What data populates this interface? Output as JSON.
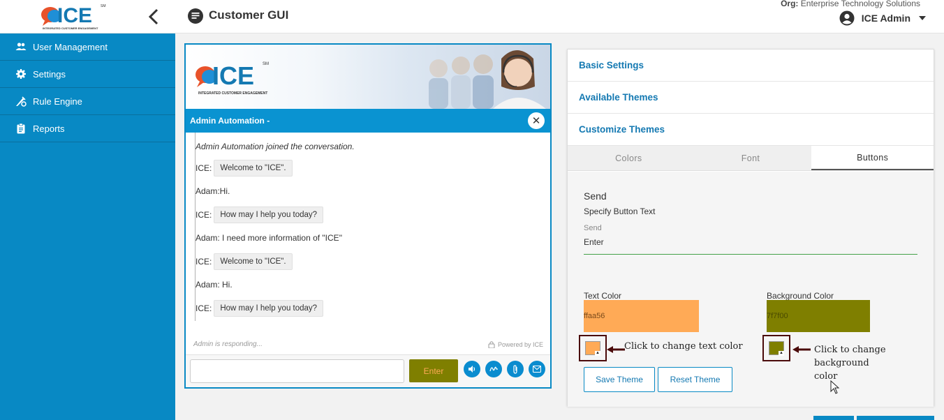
{
  "app": {
    "logo_text": "ICE",
    "logo_sm": "SM",
    "logo_tag": "INTEGRATED CUSTOMER ENGAGEMENT"
  },
  "sidebar": {
    "items": [
      {
        "label": "User Management",
        "icon": "users-icon"
      },
      {
        "label": "Settings",
        "icon": "gear-icon"
      },
      {
        "label": "Rule Engine",
        "icon": "rule-engine-icon"
      },
      {
        "label": "Reports",
        "icon": "clipboard-icon"
      }
    ]
  },
  "header": {
    "title": "Customer GUI",
    "org_label": "Org:",
    "org_name": "Enterprise Technology Solutions",
    "user_name": "ICE Admin"
  },
  "chat": {
    "agent_title": "Admin Automation -",
    "close_glyph": "✕",
    "joined": "Admin Automation joined the conversation.",
    "messages": [
      {
        "from": "ICE:",
        "text": "Welcome to \"ICE\".",
        "bubble": true
      },
      {
        "from": "",
        "text": "Adam:Hi.",
        "bubble": false
      },
      {
        "from": "ICE:",
        "text": "How may I help you today?",
        "bubble": true
      },
      {
        "from": "",
        "text": "Adam: I need more information of \"ICE\"",
        "bubble": false
      },
      {
        "from": "ICE:",
        "text": "Welcome to \"ICE\".",
        "bubble": true
      },
      {
        "from": "",
        "text": "Adam: Hi.",
        "bubble": false
      },
      {
        "from": "ICE:",
        "text": "How may I help you today?",
        "bubble": true
      }
    ],
    "responding": "Admin is responding...",
    "powered_by": "Powered by ICE",
    "input_value": "",
    "enter_label": "Enter",
    "action_icons": [
      "speaker-icon",
      "signature-icon",
      "attachment-icon",
      "email-icon"
    ]
  },
  "settings": {
    "sections": [
      "Basic Settings",
      "Available Themes",
      "Customize Themes"
    ],
    "tabs": [
      "Colors",
      "Font",
      "Buttons"
    ],
    "active_tab": "Buttons",
    "button_title": "Send",
    "button_subtitle": "Specify Button Text",
    "field_label": "Send",
    "field_value": "Enter",
    "text_color_label": "Text Color",
    "text_color_value": "ffaa56",
    "bg_color_label": "Background Color",
    "bg_color_value": "7f7f00",
    "note_text": "Click to change text color",
    "note_bg_line1": "Click to change background",
    "note_bg_line2": "color",
    "save_label": "Save Theme",
    "reset_label": "Reset Theme"
  },
  "colors": {
    "sidebar": "#0889c4",
    "text_color": "#ffaa56",
    "bg_color": "#7f7f00",
    "link": "#1479b2"
  }
}
